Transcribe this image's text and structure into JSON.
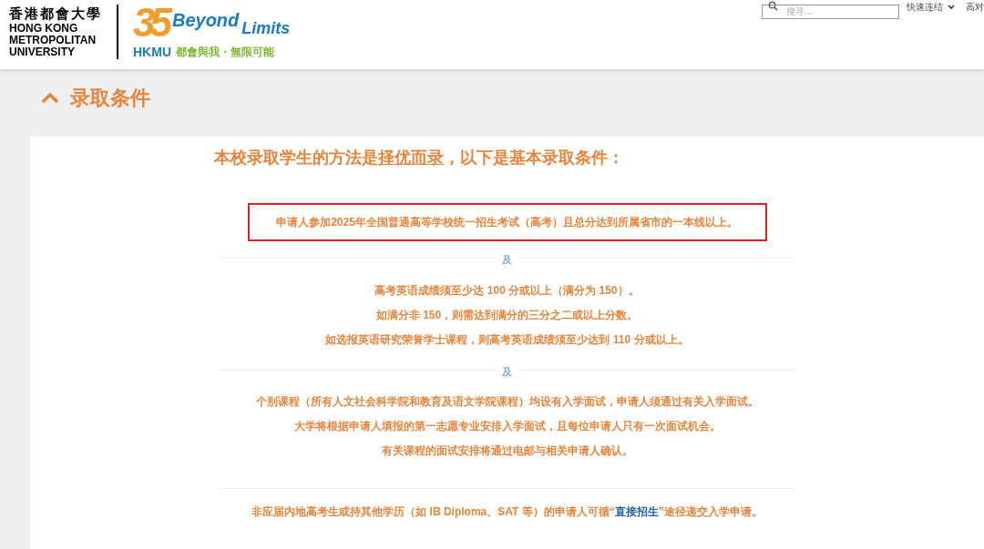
{
  "header": {
    "logo": {
      "chinese_name": "香港都會大學",
      "english_name": [
        "HONG KONG",
        "METROPOLITAN",
        "UNIVERSITY"
      ],
      "anniversary": "35",
      "slogan_en_1": "Beyond",
      "slogan_en_2": "Limits",
      "short_name": "HKMU",
      "slogan_zh": "都會與我・無限可能"
    },
    "search": {
      "placeholder": "搜寻..."
    },
    "quick_links": "快速连结",
    "cut_link": "高对"
  },
  "section": {
    "title": "录取条件",
    "expanded": true
  },
  "intro": {
    "before": "本校录取学生的方法是",
    "emphasis": "择优而录",
    "after": "，以下是基本录取条件："
  },
  "highlighted_requirement": "申请人参加2025年全国普通高等学校统一招生考试（高考）且总分达到所属省市的一本线以上。",
  "groups": [
    {
      "connector": "及",
      "lines": [
        "高考英语成绩须至少达 100 分或以上（满分为 150）。",
        "如满分非 150，则需达到满分的三分之二或以上分数。",
        "如选报英语研究荣誉学士课程，则高考英语成绩须至少达到 110 分或以上。"
      ]
    },
    {
      "connector": "及",
      "lines": [
        "个别课程（所有人文社会科学院和教育及语文学院课程）均设有入学面试，申请人须通过有关入学面试。",
        "大学将根据申请人填报的第一志愿专业安排入学面试，且每位申请人只有一次面试机会。",
        "有关课程的面试安排将通过电邮与相关申请人确认。"
      ]
    }
  ],
  "footnote": {
    "before": "非应届内地高考生或持其他学历（如 IB Diploma、SAT 等）的申请人可循“",
    "link": "直接招生",
    "after": "”途径递交入学申请。"
  }
}
